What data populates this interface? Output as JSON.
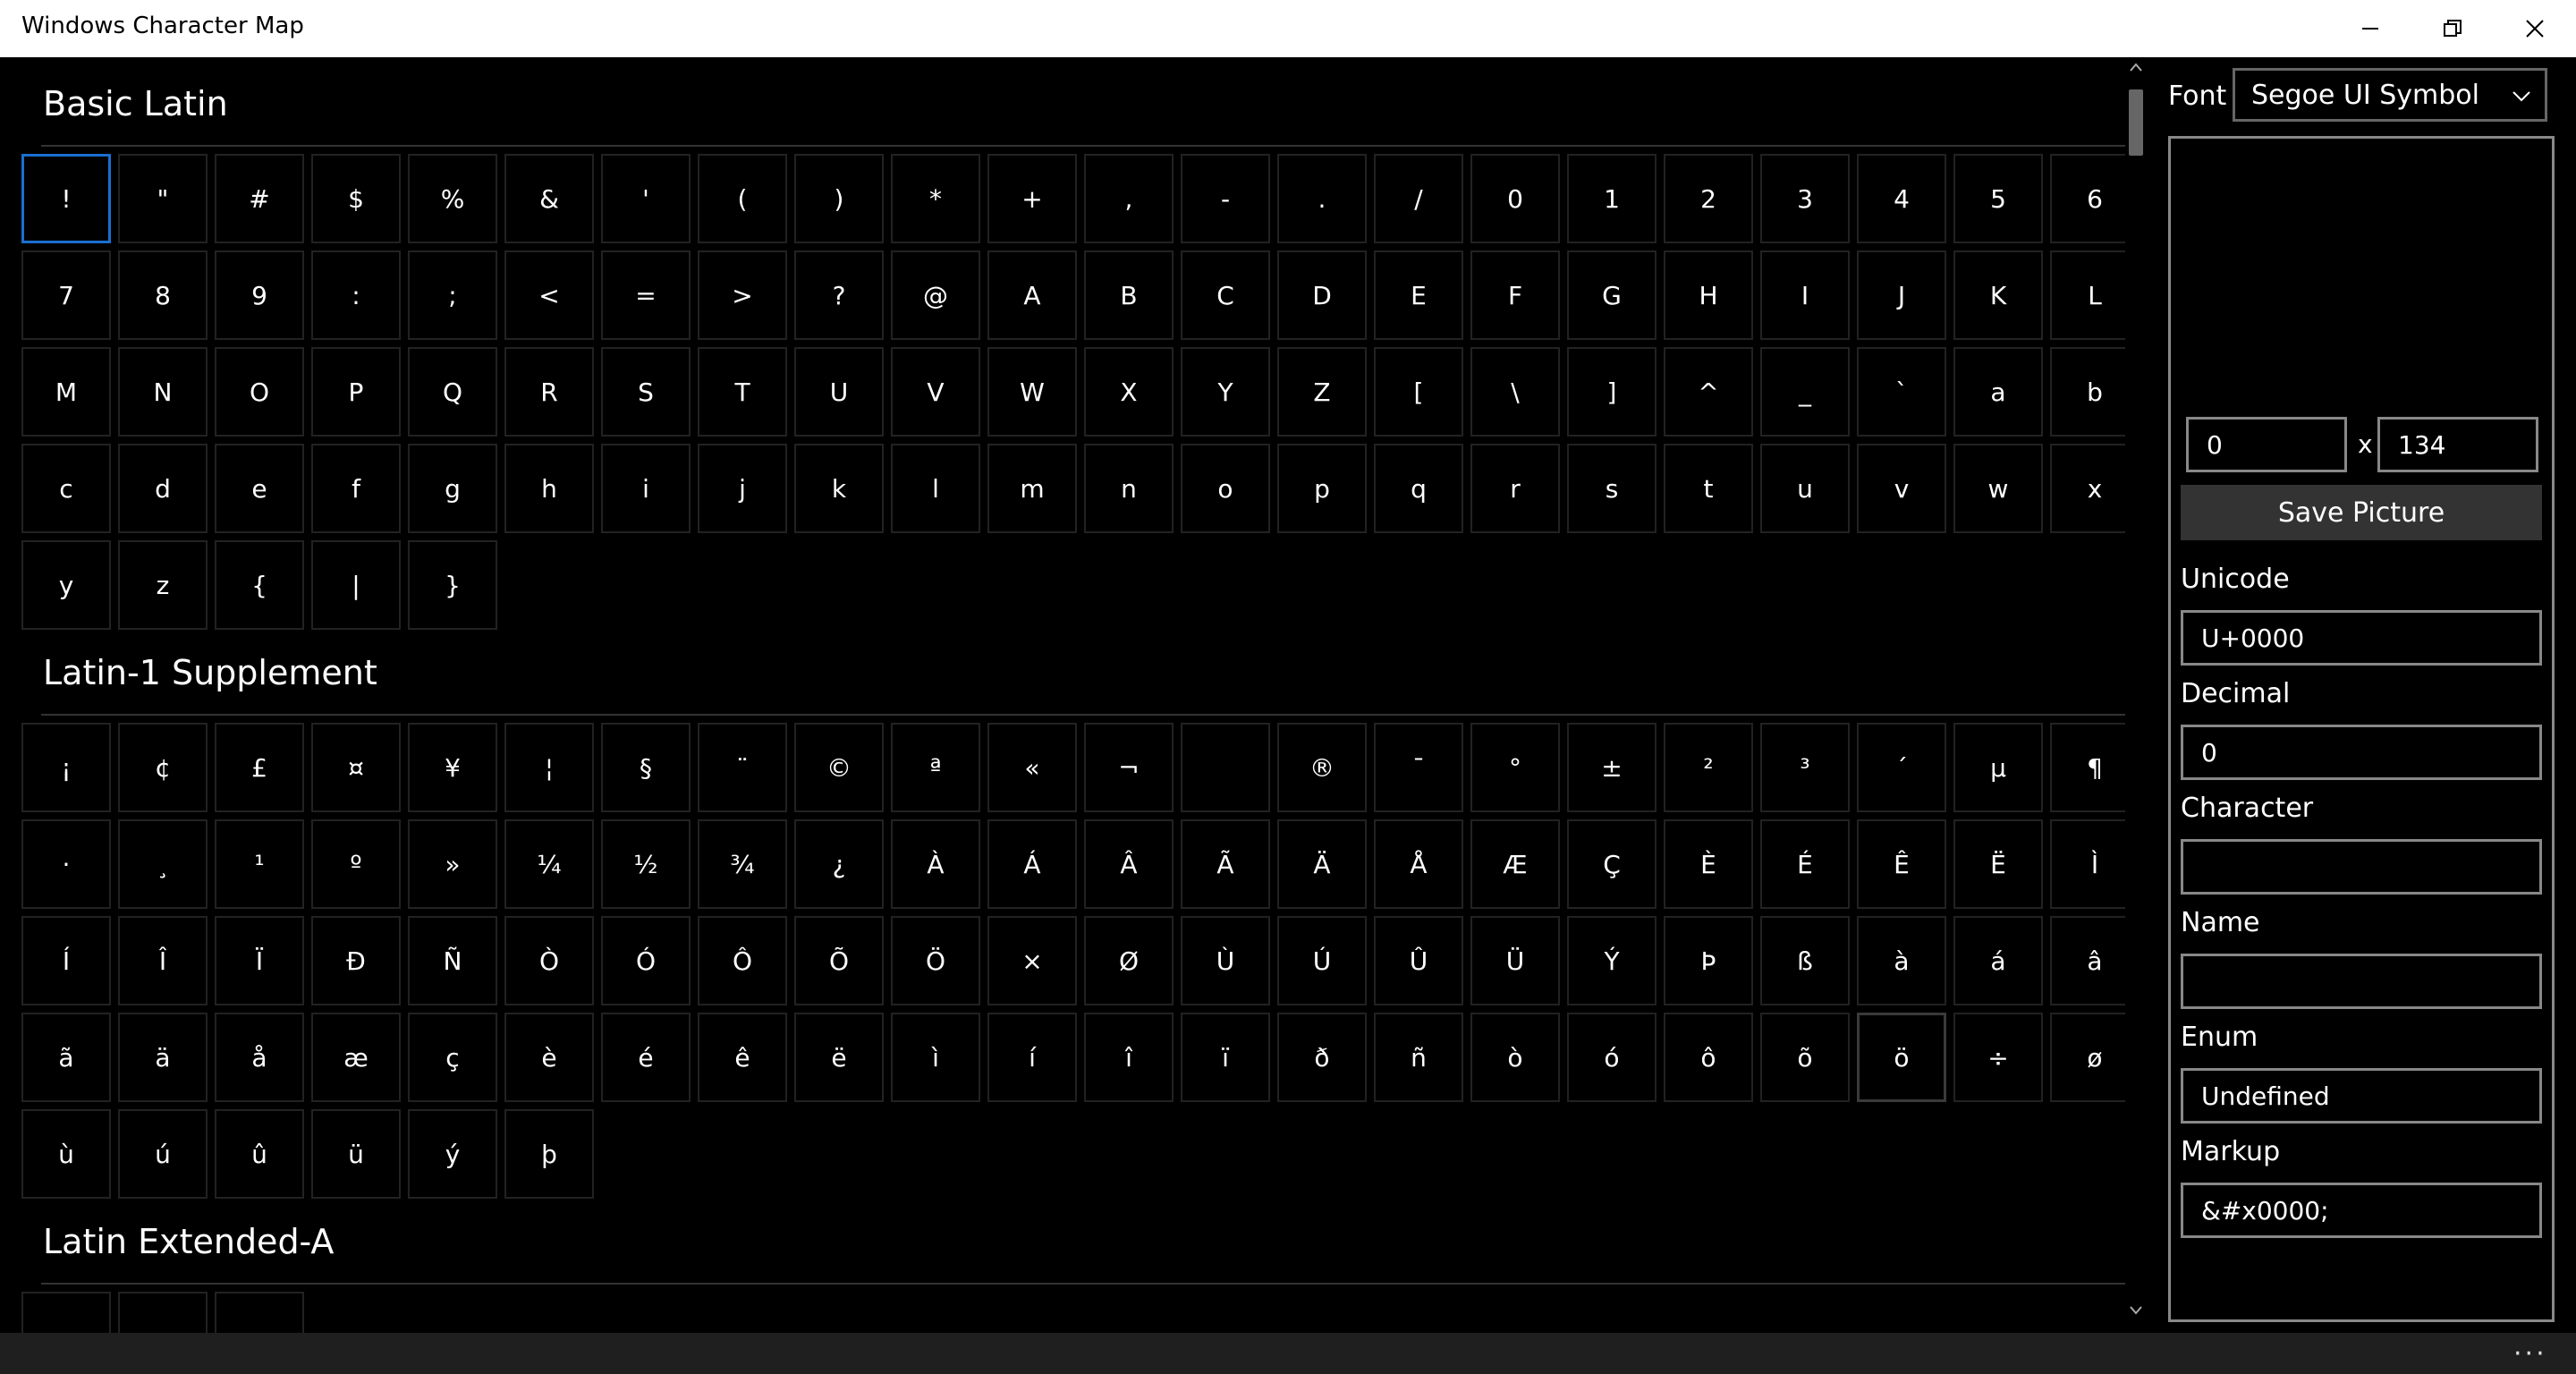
{
  "window": {
    "title": "Windows Character Map"
  },
  "sections": [
    {
      "title": "Basic Latin",
      "chars": [
        "!",
        "\"",
        "#",
        "$",
        "%",
        "&",
        "'",
        "(",
        ")",
        "*",
        "+",
        ",",
        "-",
        ".",
        "/",
        "0",
        "1",
        "2",
        "3",
        "4",
        "5",
        "6",
        "7",
        "8",
        "9",
        ":",
        ";",
        "<",
        "=",
        ">",
        "?",
        "@",
        "A",
        "B",
        "C",
        "D",
        "E",
        "F",
        "G",
        "H",
        "I",
        "J",
        "K",
        "L",
        "M",
        "N",
        "O",
        "P",
        "Q",
        "R",
        "S",
        "T",
        "U",
        "V",
        "W",
        "X",
        "Y",
        "Z",
        "[",
        "\\",
        "]",
        "^",
        "_",
        "`",
        "a",
        "b",
        "c",
        "d",
        "e",
        "f",
        "g",
        "h",
        "i",
        "j",
        "k",
        "l",
        "m",
        "n",
        "o",
        "p",
        "q",
        "r",
        "s",
        "t",
        "u",
        "v",
        "w",
        "x",
        "y",
        "z",
        "{",
        "|",
        "}"
      ],
      "selected_index": 0
    },
    {
      "title": "Latin-1 Supplement",
      "chars": [
        "¡",
        "¢",
        "£",
        "¤",
        "¥",
        "¦",
        "§",
        "¨",
        "©",
        "ª",
        "«",
        "¬",
        "",
        "®",
        "¯",
        "°",
        "±",
        "²",
        "³",
        "´",
        "µ",
        "¶",
        "·",
        "¸",
        "¹",
        "º",
        "»",
        "¼",
        "½",
        "¾",
        "¿",
        "À",
        "Á",
        "Â",
        "Ã",
        "Ä",
        "Å",
        "Æ",
        "Ç",
        "È",
        "É",
        "Ê",
        "Ë",
        "Ì",
        "Í",
        "Î",
        "Ï",
        "Ð",
        "Ñ",
        "Ò",
        "Ó",
        "Ô",
        "Õ",
        "Ö",
        "×",
        "Ø",
        "Ù",
        "Ú",
        "Û",
        "Ü",
        "Ý",
        "Þ",
        "ß",
        "à",
        "á",
        "â",
        "ã",
        "ä",
        "å",
        "æ",
        "ç",
        "è",
        "é",
        "ê",
        "ë",
        "ì",
        "í",
        "î",
        "ï",
        "ð",
        "ñ",
        "ò",
        "ó",
        "ô",
        "õ",
        "ö",
        "÷",
        "ø",
        "ù",
        "ú",
        "û",
        "ü",
        "ý",
        "þ"
      ],
      "hover_index": 85
    },
    {
      "title": "Latin Extended-A",
      "chars": [
        "",
        "",
        ""
      ]
    }
  ],
  "side_panel": {
    "font_label": "Font",
    "font_value": "Segoe UI Symbol",
    "size_width": "0",
    "size_separator": "x",
    "size_height": "134",
    "save_button": "Save Picture",
    "fields": [
      {
        "label": "Unicode",
        "value": "U+0000"
      },
      {
        "label": "Decimal",
        "value": "0"
      },
      {
        "label": "Character",
        "value": ""
      },
      {
        "label": "Name",
        "value": ""
      },
      {
        "label": "Enum",
        "value": "Undefined"
      },
      {
        "label": "Markup",
        "value": "&#x0000;"
      }
    ]
  },
  "statusbar": {
    "more": "···"
  },
  "colors": {
    "accent": "#1a6fd0",
    "background": "#000000",
    "titlebar": "#ffffff"
  }
}
